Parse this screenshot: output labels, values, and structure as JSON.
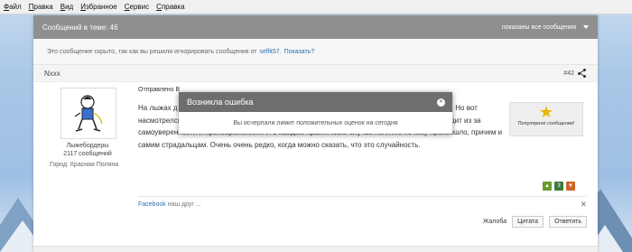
{
  "menubar": {
    "items": [
      "Файл",
      "Правка",
      "Вид",
      "Избранное",
      "Сервис",
      "Справка"
    ]
  },
  "topic": {
    "header_left": "Сообщений в теме: 46",
    "header_right": "показаны все сообщения"
  },
  "hidden_message": {
    "text": "Это сообщение скрыто, так как вы решили игнорировать сообщения от",
    "user": "selfit57.",
    "show_link": "Показать?"
  },
  "post": {
    "username": "Nxxx",
    "number": "#42",
    "author_title": "Лыжебордеры",
    "author_posts": "2117 сообщений",
    "city_label": "Город:",
    "city": "Красная Поляна",
    "sent_label": "Отправлено В",
    "text": "На лыжах д                                                             100 дней с 6 утра до 6 ве                                                                      нет, ну не считая ушибов и мелочей... Наверное везет... Но вот насмотрелся я ох чего... Даже и писать не буду. 95 % всего треша по моему мнению происходит из за самоуверенности и пренебрежения... И в каждом практически случае понятно почему произошло, причем и самим страдальцам. Очень очень редко, когда можно сказать, что это случайность.",
    "badge_label": "Популярное сообщение!",
    "vote_count": "3",
    "facebook_label": "Facebook",
    "facebook_text": "наш друг ...",
    "complaint": "Жалоба",
    "quote_button": "Цитата",
    "reply_button": "Ответить"
  },
  "modal": {
    "title": "Возникла ошибка",
    "message": "Вы исчерпали лимит положительных оценок на сегодня"
  },
  "colors": {
    "header_bg": "#8f8f8f",
    "modal_header_bg": "#6e6e6e",
    "link": "#2a6fb0"
  }
}
